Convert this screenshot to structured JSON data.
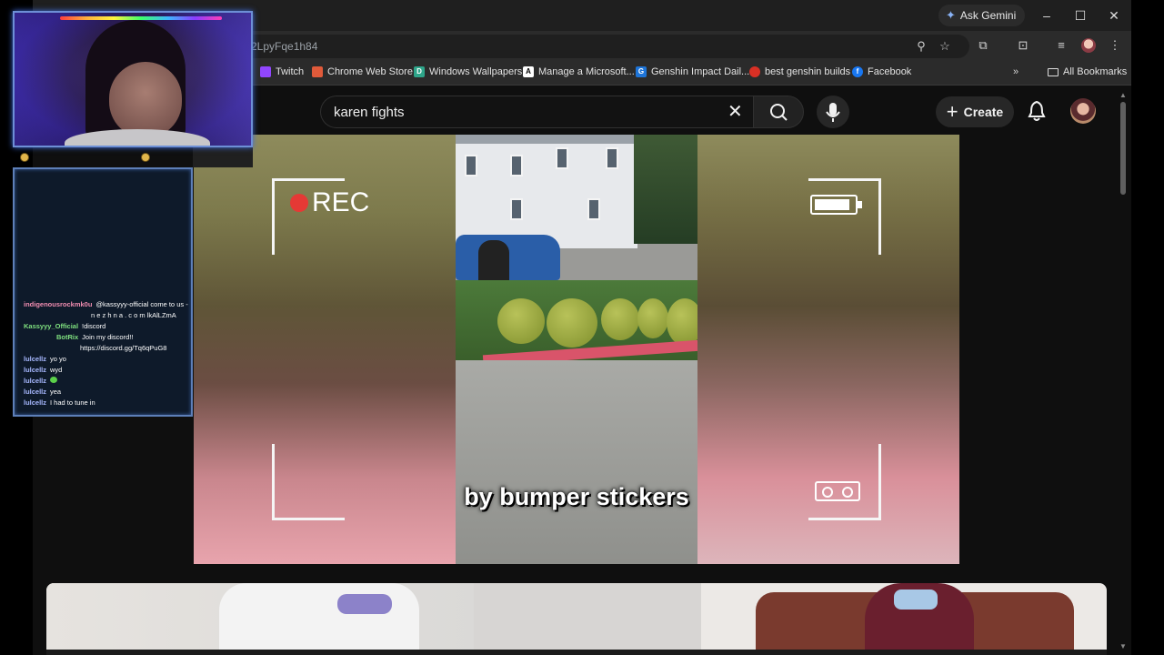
{
  "browser": {
    "url_fragment": "2LpyFqe1h84",
    "ask_gemini_label": "Ask Gemini",
    "bookmarks": [
      {
        "label": "Twitch",
        "color": "#9146ff"
      },
      {
        "label": "Chrome Web Store",
        "color": "#e05a3a"
      },
      {
        "label": "Windows Wallpapers",
        "color": "#2ea58a"
      },
      {
        "label": "Manage a Microsoft...",
        "color": "#ffffff"
      },
      {
        "label": "Genshin Impact Dail...",
        "color": "#1d74d8"
      },
      {
        "label": "best genshin builds",
        "color": "#d93025"
      },
      {
        "label": "Facebook",
        "color": "#1877f2"
      }
    ],
    "all_bookmarks_label": "All Bookmarks"
  },
  "youtube": {
    "search_query": "karen fights",
    "create_label": "Create"
  },
  "video": {
    "rec_label": "REC",
    "caption": "by bumper stickers"
  },
  "chat": {
    "messages": [
      {
        "nick": "indigenousrockmk0u",
        "nick_color": "#f28db1",
        "text": "@kassyyy-official come to us -",
        "cont": "n e z h n a . c o m lkAlLZmA"
      },
      {
        "nick": "Kassyyy_Official",
        "nick_color": "#7fe07f",
        "text": "!discord",
        "cont": ""
      },
      {
        "nick": "BotRix",
        "nick_color": "#7fe07f",
        "text": "Join my discord!!",
        "cont": "https://discord.gg/Tq6qPuG8"
      },
      {
        "nick": "lulcellz",
        "nick_color": "#a7b8ff",
        "text": "yo yo",
        "cont": ""
      },
      {
        "nick": "lulcellz",
        "nick_color": "#a7b8ff",
        "text": "wyd",
        "cont": ""
      },
      {
        "nick": "lulcellz",
        "nick_color": "#a7b8ff",
        "text": "",
        "cont": ""
      },
      {
        "nick": "lulcellz",
        "nick_color": "#a7b8ff",
        "text": "yea",
        "cont": ""
      },
      {
        "nick": "lulcellz",
        "nick_color": "#a7b8ff",
        "text": "I had to tune in",
        "cont": ""
      }
    ]
  }
}
